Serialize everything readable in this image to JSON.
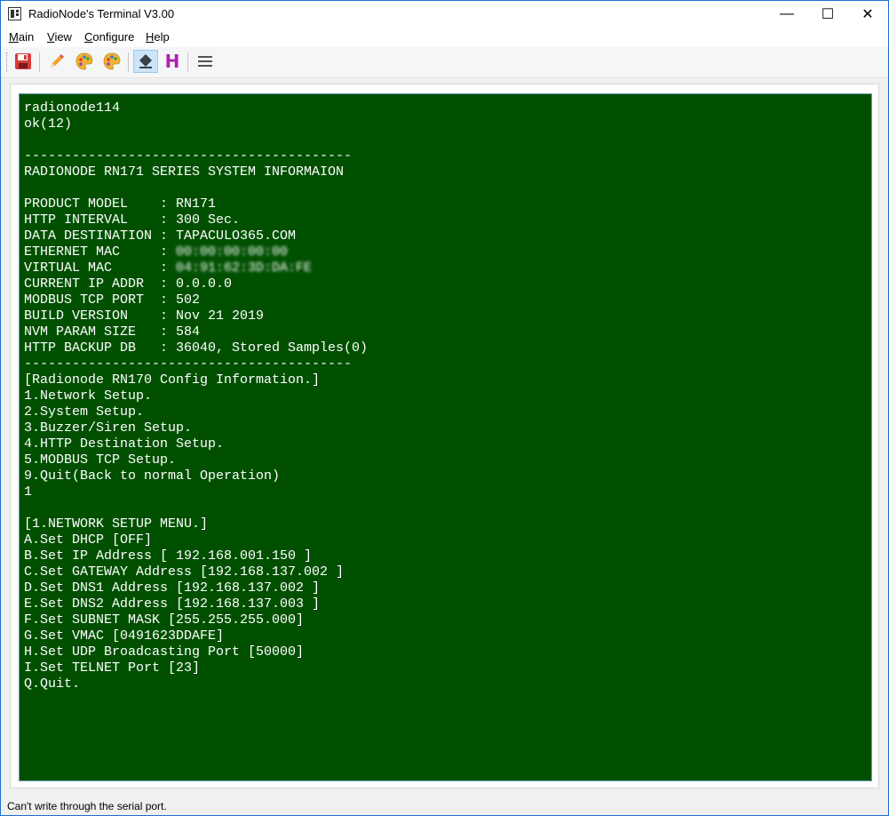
{
  "window": {
    "title": "RadioNode's Terminal V3.00",
    "controls": {
      "minimize": "—",
      "maximize": "☐",
      "close": "✕"
    }
  },
  "menu": {
    "items": [
      {
        "hotkey": "M",
        "rest": "ain"
      },
      {
        "hotkey": "V",
        "rest": "iew"
      },
      {
        "hotkey": "C",
        "rest": "onfigure"
      },
      {
        "hotkey": "H",
        "rest": "elp"
      }
    ]
  },
  "toolbar": {
    "icons": [
      "save-icon",
      "pencil-icon",
      "palette-icon",
      "palette-icon",
      "eraser-icon",
      "h-icon",
      "menu-icon"
    ],
    "h_label": "H",
    "colors": {
      "save_red": "#d83b3b",
      "pencil": "#f0a030",
      "palette": "#f2b233",
      "h_purple": "#b020b0"
    }
  },
  "terminal": {
    "background": "#005000",
    "foreground": "#ffffff",
    "lines": [
      {
        "text": "radionode114"
      },
      {
        "text": "ok(12)"
      },
      {
        "text": ""
      },
      {
        "text": "-----------------------------------------"
      },
      {
        "text": "RADIONODE RN171 SERIES SYSTEM INFORMAION"
      },
      {
        "text": ""
      },
      {
        "text": "PRODUCT MODEL    : RN171"
      },
      {
        "text": "HTTP INTERVAL    : 300 Sec."
      },
      {
        "text": "DATA DESTINATION : TAPACULO365.COM"
      },
      {
        "text": "ETHERNET MAC     : ",
        "hidden": "00:00:00:00:00"
      },
      {
        "text": "VIRTUAL MAC      : ",
        "hidden": "04:91:62:3D:DA:FE"
      },
      {
        "text": "CURRENT IP ADDR  : 0.0.0.0"
      },
      {
        "text": "MODBUS TCP PORT  : 502"
      },
      {
        "text": "BUILD VERSION    : Nov 21 2019"
      },
      {
        "text": "NVM PARAM SIZE   : 584"
      },
      {
        "text": "HTTP BACKUP DB   : 36040, Stored Samples(0)"
      },
      {
        "text": "-----------------------------------------"
      },
      {
        "text": "[Radionode RN170 Config Information.]"
      },
      {
        "text": "1.Network Setup."
      },
      {
        "text": "2.System Setup."
      },
      {
        "text": "3.Buzzer/Siren Setup."
      },
      {
        "text": "4.HTTP Destination Setup."
      },
      {
        "text": "5.MODBUS TCP Setup."
      },
      {
        "text": "9.Quit(Back to normal Operation)"
      },
      {
        "text": "1"
      },
      {
        "text": ""
      },
      {
        "text": "[1.NETWORK SETUP MENU.]"
      },
      {
        "text": "A.Set DHCP [OFF]"
      },
      {
        "text": "B.Set IP Address [ 192.168.001.150 ]"
      },
      {
        "text": "C.Set GATEWAY Address [192.168.137.002 ]"
      },
      {
        "text": "D.Set DNS1 Address [192.168.137.002 ]"
      },
      {
        "text": "E.Set DNS2 Address [192.168.137.003 ]"
      },
      {
        "text": "F.Set SUBNET MASK [255.255.255.000]"
      },
      {
        "text": "G.Set VMAC [0491623DDAFE]"
      },
      {
        "text": "H.Set UDP Broadcasting Port [50000]"
      },
      {
        "text": "I.Set TELNET Port [23]"
      },
      {
        "text": "Q.Quit."
      }
    ]
  },
  "status": {
    "text": "Can't write through the serial port."
  }
}
